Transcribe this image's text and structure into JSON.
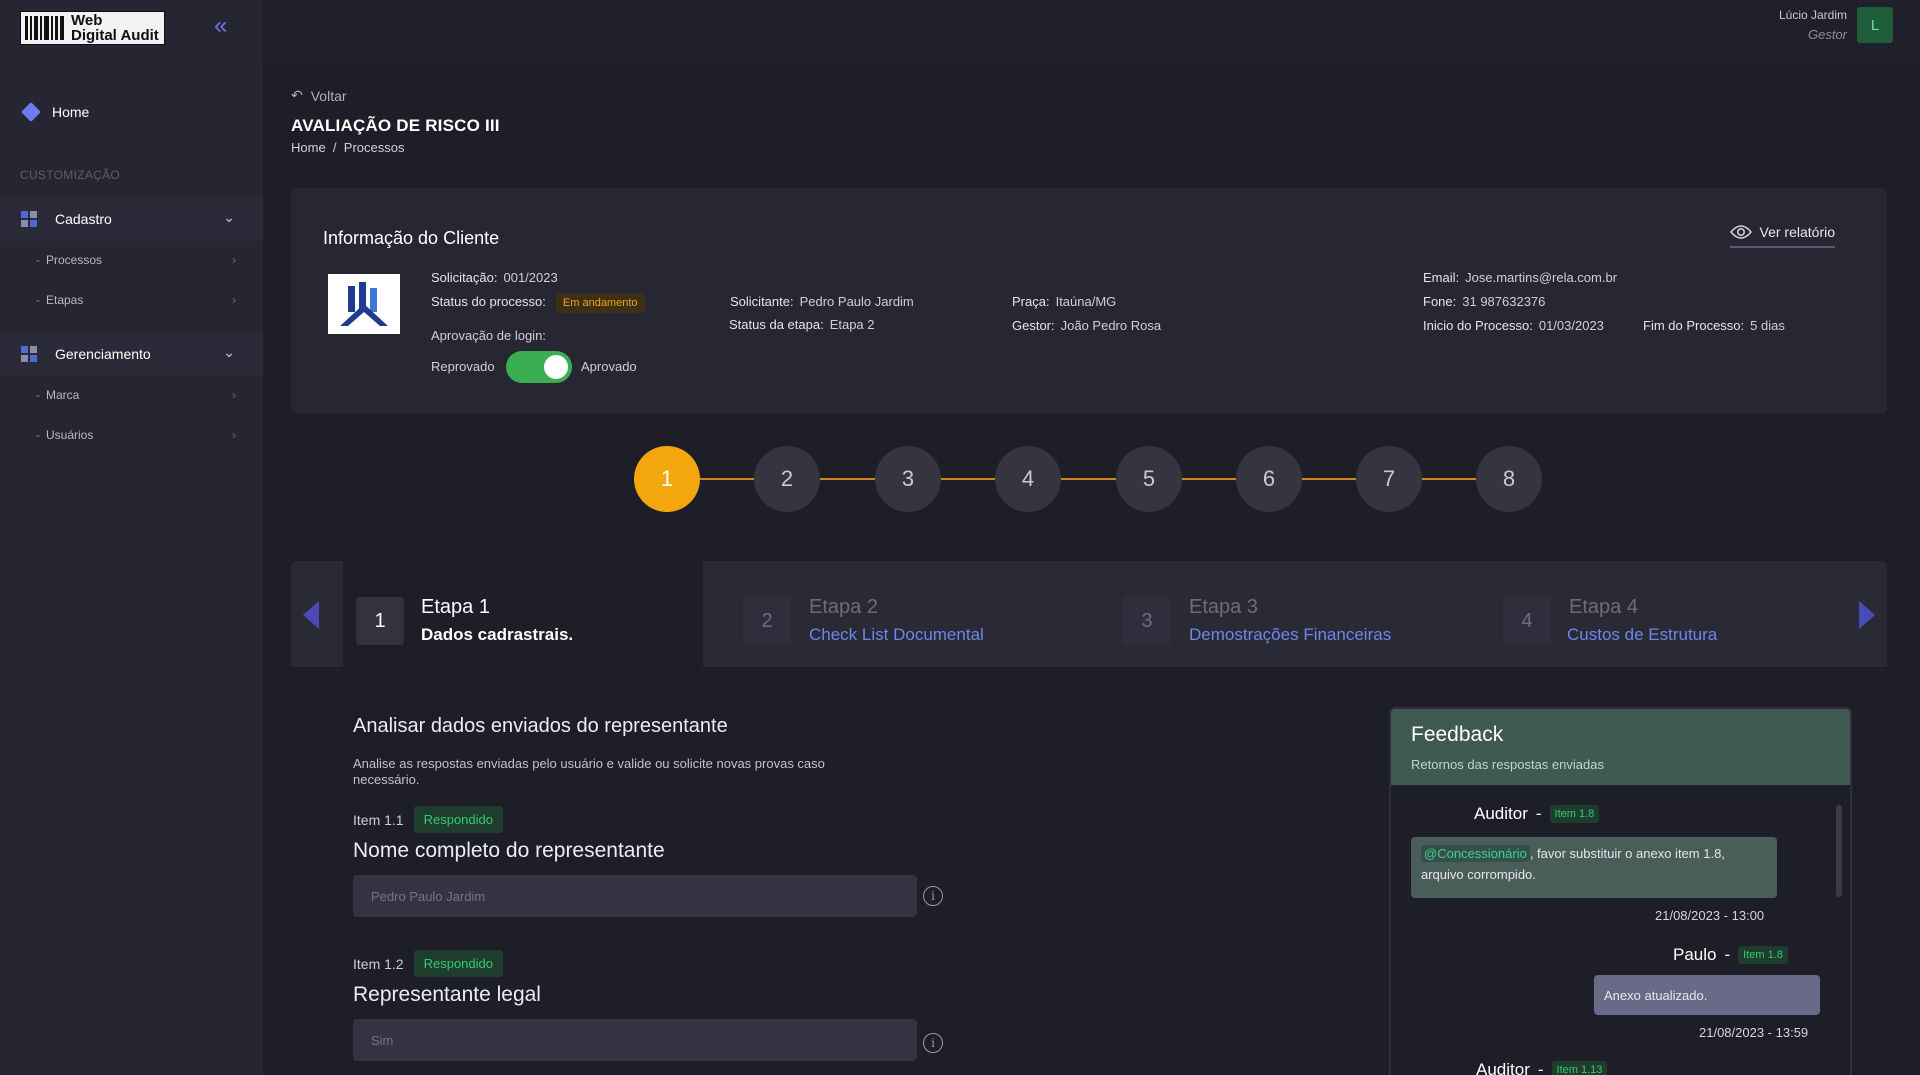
{
  "sidebar": {
    "logo_line1": "Web",
    "logo_line2": "Digital Audit",
    "home": "Home",
    "section": "CUSTOMIZAÇÃO",
    "groups": [
      {
        "label": "Cadastro",
        "items": [
          "Processos",
          "Etapas"
        ]
      },
      {
        "label": "Gerenciamento",
        "items": [
          "Marca",
          "Usuários"
        ]
      }
    ]
  },
  "user": {
    "name": "Lúcio Jardim",
    "role": "Gestor",
    "initial": "L"
  },
  "header": {
    "back": "Voltar",
    "title": "AVALIAÇÃO DE RISCO III",
    "breadcrumb": [
      "Home",
      "Processos"
    ]
  },
  "client": {
    "title": "Informação do Cliente",
    "report_link": "Ver relatório",
    "solicitacao_label": "Solicitação:",
    "solicitacao_value": "001/2023",
    "status_label": "Status do processo:",
    "status_value": "Em andamento",
    "aprovacao_label": "Aprovação de login:",
    "toggle_off": "Reprovado",
    "toggle_on": "Aprovado",
    "solicitante_label": "Solicitante:",
    "solicitante_value": "Pedro Paulo Jardim",
    "status_etapa_label": "Status da etapa:",
    "status_etapa_value": "Etapa 2",
    "praca_label": "Praça:",
    "praca_value": "Itaúna/MG",
    "gestor_label": "Gestor:",
    "gestor_value": "João Pedro Rosa",
    "email_label": "Email:",
    "email_value": "Jose.martins@rela.com.br",
    "fone_label": "Fone:",
    "fone_value": "31 987632376",
    "inicio_label": "Inicio do Processo:",
    "inicio_value": "01/03/2023",
    "fim_label": "Fim do Processo:",
    "fim_value": "5 dias"
  },
  "stepper": {
    "steps": [
      "1",
      "2",
      "3",
      "4",
      "5",
      "6",
      "7",
      "8"
    ],
    "active": 1
  },
  "tabs": [
    {
      "num": "1",
      "title": "Etapa 1",
      "subtitle": "Dados cadrastrais."
    },
    {
      "num": "2",
      "title": "Etapa 2",
      "subtitle": "Check List Documental"
    },
    {
      "num": "3",
      "title": "Etapa 3",
      "subtitle": "Demostrações Financeiras"
    },
    {
      "num": "4",
      "title": "Etapa 4",
      "subtitle": "Custos de Estrutura"
    }
  ],
  "section": {
    "title": "Analisar dados enviados do representante",
    "desc": "Analise as respostas enviadas pelo usuário e valide ou solicite novas provas caso necessário."
  },
  "items": [
    {
      "label": "Item 1.1",
      "status": "Respondido",
      "question": "Nome completo do representante",
      "value": "Pedro Paulo Jardim"
    },
    {
      "label": "Item 1.2",
      "status": "Respondido",
      "question": "Representante legal",
      "value": "Sim"
    }
  ],
  "feedback": {
    "title": "Feedback",
    "subtitle": "Retornos das respostas enviadas",
    "messages": [
      {
        "author": "Auditor",
        "sep": "-",
        "tag": "Item 1.8",
        "mention": "@Concessionário",
        "text": ", favor substituir o anexo item 1.8, arquivo corrompido.",
        "time": "21/08/2023 - 13:00"
      },
      {
        "author": "Paulo",
        "sep": "-",
        "tag": "Item 1.8",
        "text": "Anexo atualizado.",
        "time": "21/08/2023 - 13:59"
      },
      {
        "author": "Auditor",
        "sep": "-",
        "tag": "Item 1.13"
      }
    ]
  },
  "colors": {
    "accent": "#f4a60e",
    "success": "#37c877",
    "link": "#6f86e6",
    "toggle": "#3cae52"
  }
}
